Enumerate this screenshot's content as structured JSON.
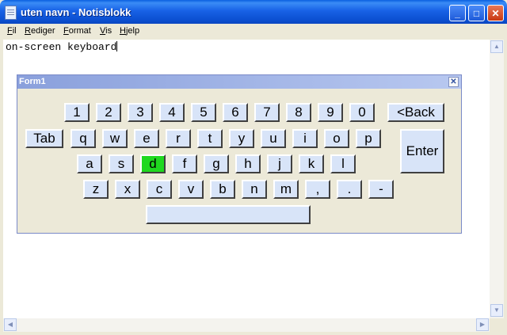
{
  "window": {
    "title": "uten navn - Notisblokk",
    "controls": {
      "minimize": "_",
      "maximize": "□",
      "close": "✕"
    }
  },
  "menu": [
    "Fil",
    "Rediger",
    "Format",
    "Vis",
    "Hjelp"
  ],
  "editor": {
    "text": "on-screen keyboard"
  },
  "form": {
    "title": "Form1",
    "close": "✕",
    "highlight_color": "#1fd81f",
    "keys": {
      "row1": [
        "1",
        "2",
        "3",
        "4",
        "5",
        "6",
        "7",
        "8",
        "9",
        "0"
      ],
      "back": "<Back",
      "tab": "Tab",
      "row2": [
        "q",
        "w",
        "e",
        "r",
        "t",
        "y",
        "u",
        "i",
        "o",
        "p"
      ],
      "enter": "Enter",
      "row3": [
        "a",
        "s",
        "d",
        "f",
        "g",
        "h",
        "j",
        "k",
        "l"
      ],
      "row4": [
        "z",
        "x",
        "c",
        "v",
        "b",
        "n",
        "m",
        ",",
        ".",
        "-"
      ],
      "space": ""
    },
    "highlighted_key": "d"
  },
  "scrollbars": {
    "up": "▲",
    "down": "▼",
    "left": "◀",
    "right": "▶"
  }
}
